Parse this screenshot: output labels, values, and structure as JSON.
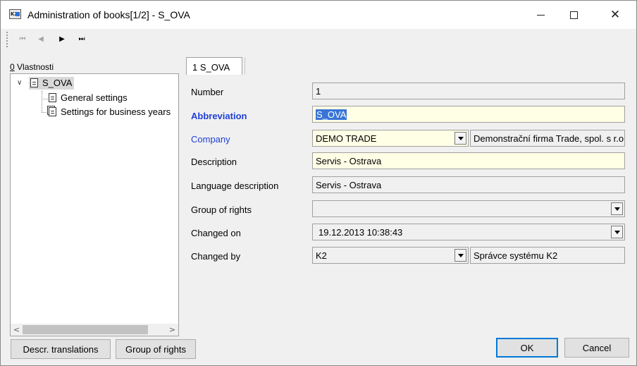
{
  "window": {
    "title": "Administration of books[1/2] - S_OVA",
    "app_icon_text": "K2"
  },
  "toolbar": {
    "first_glyph": "⏮",
    "prev_glyph": "◀",
    "next_glyph": "▶",
    "last_glyph": "⏭"
  },
  "left_panel": {
    "label_hotkey": "0",
    "label_rest": " Vlastnosti",
    "tree": {
      "root": "S_OVA",
      "children": [
        "General settings",
        "Settings for business years"
      ]
    }
  },
  "tab": {
    "label": "1 S_OVA"
  },
  "form": {
    "number": {
      "label": "Number",
      "value": "1"
    },
    "abbreviation": {
      "label": "Abbreviation",
      "value": "S_OVA"
    },
    "company": {
      "label": "Company",
      "value": "DEMO TRADE",
      "description": "Demonstrační firma Trade, spol. s r.o."
    },
    "description": {
      "label": "Description",
      "value": "Servis - Ostrava"
    },
    "language_description": {
      "label": "Language description",
      "value": "Servis - Ostrava"
    },
    "group_of_rights": {
      "label": "Group of rights",
      "value": ""
    },
    "changed_on": {
      "label": "Changed on",
      "value": "19.12.2013 10:38:43"
    },
    "changed_by": {
      "label": "Changed by",
      "value": "K2",
      "description": "Správce systému K2"
    }
  },
  "buttons": {
    "descr_translations": "Descr. translations",
    "group_of_rights": "Group of rights",
    "ok": "OK",
    "cancel": "Cancel"
  },
  "colors": {
    "accent_label": "#1f3fd6",
    "required_field_bg": "#ffffe6",
    "selection": "#3875d7",
    "default_button_border": "#0078d7"
  }
}
